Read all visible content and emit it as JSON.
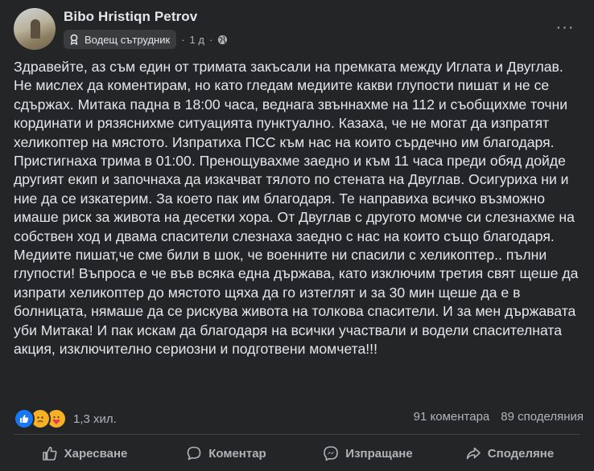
{
  "post": {
    "author": "Bibo Hristiqn Petrov",
    "badge_label": "Водещ сътрудник",
    "time": "1 д",
    "separator": "·",
    "more_label": "···",
    "text": "Здравейте, аз съм един от тримата закъсали на премката между Иглата и Двуглав. Не мислех да коментирам, но като гледам медиите какви глупости пишат и не се сдържах. Митака падна в 18:00 часа, веднага звъннахме на 112 и съобщихме точни кординати и рязяснихме ситуацията пунктуално. Казаха, че не могат да изпратят хеликоптер на мястото. Изпратиха ПСС към нас на които сърдечно им благодаря. Пристигнаха трима в 01:00. Пренощувахме заедно и към 11 часа преди обяд дойде другият екип и започнаха да изкачват тялото по стената на Двуглав. Осигуриха ни и ние да се изкатерим. За което пак им благодаря. Те направиха всичко възможно имаше риск за живота на десетки хора. От Двуглав с другото момче си слезнахме на собствен ход и двама спасители слезнаха заедно с нас на които също благодаря. Медиите пишат,че сме били в шок, че военните ни спасили с хеликоптер.. пълни глупости! Въпроса е че във всяка една държава, като изключим третия свят щеше да изпрати хеликоптер до мястото щяха да го изтеглят и за 30 мин щеше да е в болницата, нямаше да се рискува живота на толкова спасители. И за мен държавата уби Митака! И пак искам да благодаря на всички участвали и водели спасителната акция, изключително сериозни и подготвени момчета!!!"
  },
  "stats": {
    "reaction_icons": [
      "like-icon",
      "sad-icon",
      "care-icon"
    ],
    "reaction_count": "1,3 хил.",
    "comments": "91 коментара",
    "shares": "89 споделяния"
  },
  "actions": {
    "like": "Харесване",
    "comment": "Коментар",
    "send": "Изпращане",
    "share": "Споделяне"
  },
  "colors": {
    "background": "#242526",
    "text_primary": "#e4e6eb",
    "text_secondary": "#b0b3b8",
    "like_blue": "#1877f2",
    "emoji_yellow": "#f7b125"
  }
}
